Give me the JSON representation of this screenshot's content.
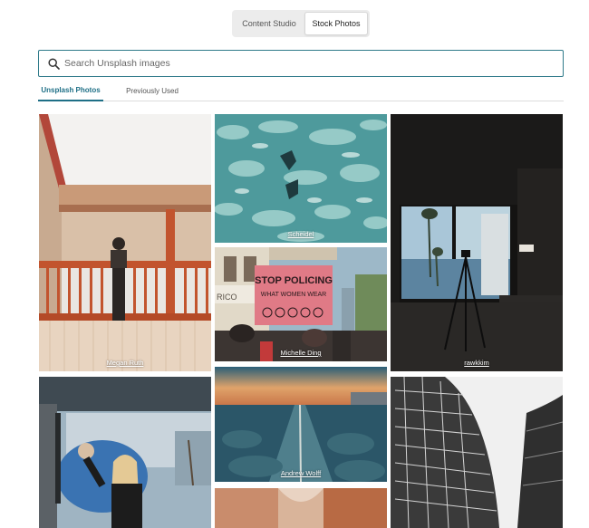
{
  "toggle": {
    "content_studio": "Content Studio",
    "stock_photos": "Stock Photos"
  },
  "search": {
    "placeholder": "Search Unsplash images",
    "value": ""
  },
  "tabs": {
    "unsplash": "Unsplash Photos",
    "previous": "Previously Used"
  },
  "photos": [
    {
      "credit": "Megan Ruth"
    },
    {
      "credit": "Scheidel"
    },
    {
      "credit": "Michelle Ding"
    },
    {
      "credit": "rawkkim"
    },
    {
      "credit": "Andrew Wolff"
    },
    {
      "sign_text": "STOP POLICING WHAT WOMEN WEAR",
      "storefront_text": "RICO"
    }
  ]
}
